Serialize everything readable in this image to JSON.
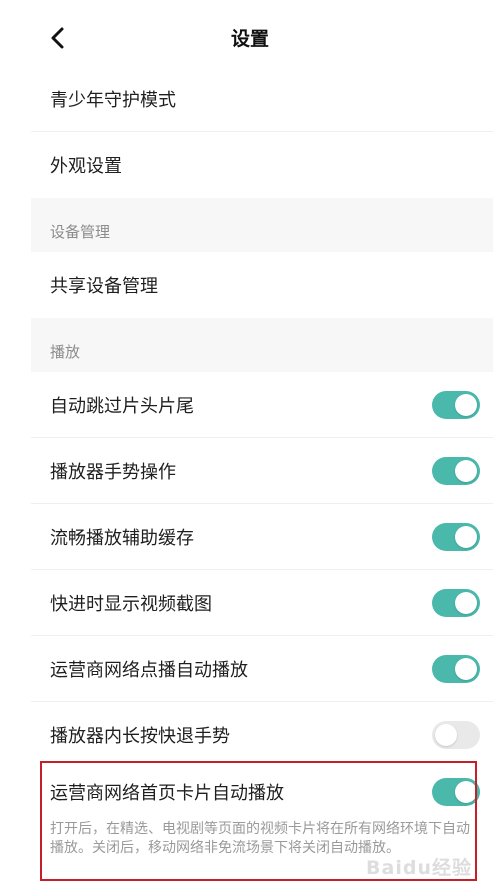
{
  "header": {
    "title": "设置",
    "back_icon": "chevron-left-icon"
  },
  "items_top": [
    {
      "label": "青少年守护模式"
    },
    {
      "label": "外观设置"
    }
  ],
  "sections": [
    {
      "label": "设备管理",
      "items": [
        {
          "label": "共享设备管理"
        }
      ]
    },
    {
      "label": "播放",
      "items": [
        {
          "label": "自动跳过片头片尾",
          "toggle": true
        },
        {
          "label": "播放器手势操作",
          "toggle": true
        },
        {
          "label": "流畅播放辅助缓存",
          "toggle": true
        },
        {
          "label": "快进时显示视频截图",
          "toggle": true
        },
        {
          "label": "运营商网络点播自动播放",
          "toggle": true
        },
        {
          "label": "播放器内长按快退手势",
          "toggle": false
        },
        {
          "label": "运营商网络首页卡片自动播放",
          "toggle": true
        }
      ]
    }
  ],
  "description": "打开后，在精选、电视剧等页面的视频卡片将在所有网络环境下自动播放。关闭后，移动网络非免流场景下将关闭自动播放。",
  "watermark": "Baidu经验",
  "colors": {
    "toggle_on": "#4ab9ac",
    "toggle_off": "#e9e9e9",
    "highlight": "#c4202a",
    "section_bg": "#f7f7f7"
  }
}
